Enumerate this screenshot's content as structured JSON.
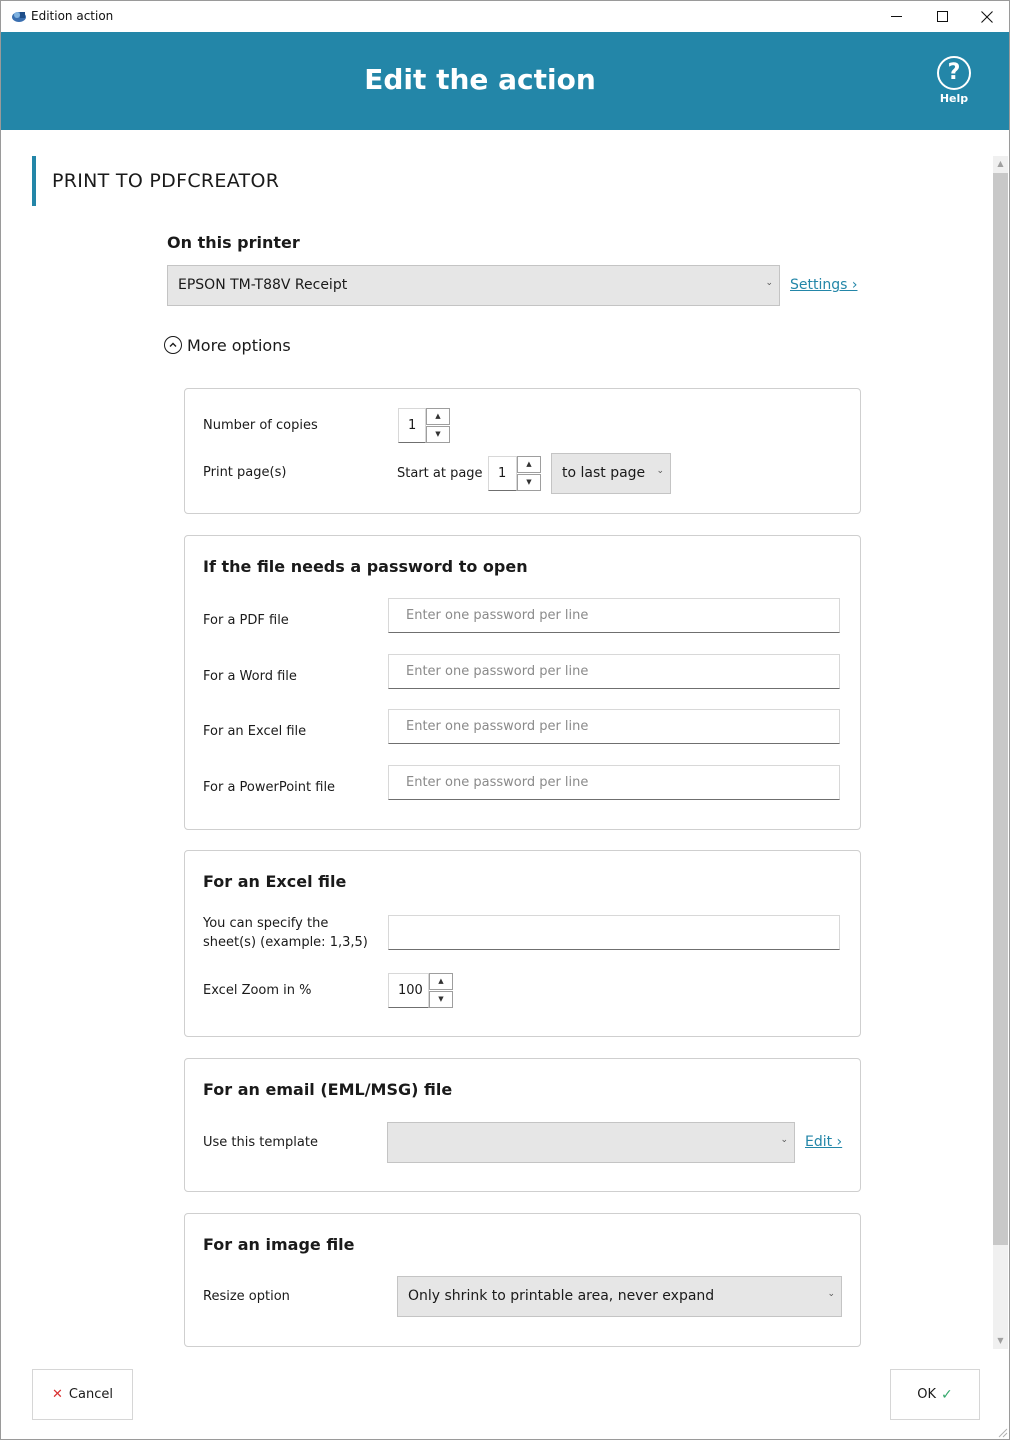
{
  "window": {
    "title": "Edition action",
    "icon": "app-icon",
    "controls": {
      "minimize": "minimize-icon",
      "maximize": "maximize-icon",
      "close": "close-icon"
    }
  },
  "header": {
    "title": "Edit the action",
    "help_label": "Help",
    "help_glyph": "?",
    "background": "#2386a8"
  },
  "section": {
    "title": "PRINT TO PDFCREATOR"
  },
  "printer": {
    "label": "On this printer",
    "selected": "EPSON TM-T88V Receipt",
    "settings_link": "Settings ›"
  },
  "more_options": {
    "label": "More options",
    "expanded": true
  },
  "copies_card": {
    "copies_label": "Number of copies",
    "copies_value": "1",
    "pages_label": "Print page(s)",
    "start_label": "Start at page",
    "start_value": "1",
    "range_selected": "to last page"
  },
  "password_card": {
    "heading": "If the file needs a password to open",
    "pdf_label": "For a PDF file",
    "word_label": "For a Word file",
    "excel_label": "For an Excel file",
    "ppt_label": "For a PowerPoint file",
    "placeholder": "Enter one password per line"
  },
  "excel_card": {
    "heading": "For an Excel file",
    "sheets_label_line1": "You can specify the",
    "sheets_label_line2": "sheet(s) (example: 1,3,5)",
    "sheets_value": "",
    "zoom_label": "Excel Zoom in %",
    "zoom_value": "100"
  },
  "email_card": {
    "heading": "For an email (EML/MSG) file",
    "template_label": "Use this template",
    "template_selected": "",
    "edit_link": "Edit ›"
  },
  "image_card": {
    "heading": "For an image file",
    "resize_label": "Resize option",
    "resize_selected": "Only shrink to printable area, never expand"
  },
  "footer": {
    "cancel_label": "Cancel",
    "ok_label": "OK",
    "cancel_color": "#d93030",
    "ok_check_color": "#34a86b"
  }
}
